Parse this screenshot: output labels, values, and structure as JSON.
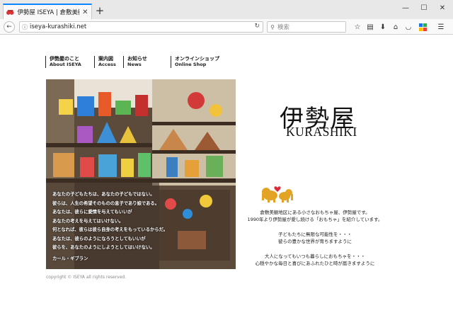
{
  "browser": {
    "tab_title": "伊勢屋 ISEYA | 倉敷美観地区",
    "tab_close": "✕",
    "new_tab": "+",
    "url": "iseya-kurashiki.net",
    "search_placeholder": "検索",
    "minimize": "—",
    "maximize": "☐",
    "close": "✕"
  },
  "site": {
    "menu": [
      {
        "ja": "伊勢屋のこと",
        "en": "About ISEYA"
      },
      {
        "ja": "案内図",
        "en": "Access"
      },
      {
        "ja": "お知らせ",
        "en": "News"
      },
      {
        "ja": "オンラインショップ",
        "en": "Online Shop"
      }
    ],
    "quote": [
      "あなたの子どもたちは、あなたの子どもではない。",
      "彼らは、人生の希望そのものの息子であり娘である。",
      "あなたは、彼らに愛情を与えてもいいが",
      "あなたの考えを与えてはいけない。",
      "何となれば、彼らは彼ら自身の考えをもっているからだ。",
      "あなたは、彼らのようになろうとしてもいいが",
      "彼らを、あなたのようにしようとしてはいけない。",
      "カール・ギブラン"
    ],
    "logo_ja": "伊勢屋",
    "logo_en": "KURASHIKI",
    "intro_1": [
      "倉敷美観地区にある小さなおもちゃ屋、伊勢屋です。",
      "1990年より伊勢屋が愛し続ける「おもちゃ」を紹介しています。"
    ],
    "intro_2": [
      "子どもたちに無限な可能性を・・・",
      "彼らの豊かな世界が育ちますように"
    ],
    "intro_3": [
      "大人になってもいつも暮らしにおもちゃを・・・",
      "心穏やかな毎日と喜びにあふれたひと時が届きますように"
    ],
    "copyright": "copyright © ISEYA all rights reserved."
  }
}
